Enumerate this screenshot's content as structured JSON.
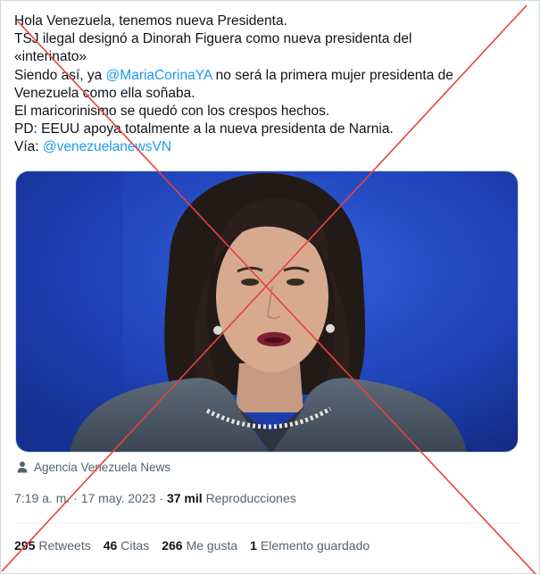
{
  "tweet": {
    "lines": [
      "Hola Venezuela, tenemos nueva Presidenta.",
      "TSJ ilegal designó a Dinorah Figuera como nueva presidenta del",
      "«interinato»"
    ],
    "line4_before": "Siendo así, ya ",
    "mention1": "@MariaCorinaYA",
    "line4_after": " no será la primera mujer presidenta de",
    "line5": "Venezuela como ella soñaba.",
    "line6": "El maricorinismo se quedó con los crespos hechos.",
    "line7": "PD: EEUU apoya totalmente a la nueva presidenta de Narnia.",
    "line8_before": "Vía: ",
    "mention2": "@venezuelanewsVN"
  },
  "source": {
    "icon": "person-icon",
    "name": "Agencia Venezuela News"
  },
  "meta": {
    "time": "7:19 a. m.",
    "separator": " · ",
    "date": "17 may. 2023",
    "views_count": "37 mil",
    "views_label": "Reproducciones"
  },
  "stats": {
    "retweets_count": "295",
    "retweets_label": "Retweets",
    "quotes_count": "46",
    "quotes_label": "Citas",
    "likes_count": "266",
    "likes_label": "Me gusta",
    "bookmarks_count": "1",
    "bookmarks_label": "Elemento guardado"
  },
  "colors": {
    "link": "#1d9bf0",
    "secondary_text": "#536471",
    "cross": "#e8413f",
    "media_background": "#1d3fb0"
  }
}
